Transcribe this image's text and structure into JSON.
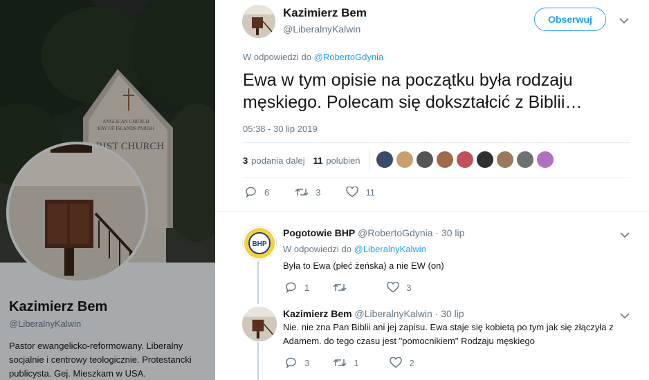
{
  "profile": {
    "name": "Kazimierz Bem",
    "handle": "@LiberalnyKalwin",
    "bio": "Pastor ewangelicko-reformowany. Liberalny socjalnie i centrowy teologicznie. Protestancki publicysta. Gej. Mieszkam w USA."
  },
  "banner_sign": {
    "line1": "ANGLICAN CHURCH",
    "line2": "BAY OF ISLANDS PARISH",
    "line3": "RIST CHURCH"
  },
  "tweet": {
    "author_name": "Kazimierz Bem",
    "author_handle": "@LiberalnyKalwin",
    "follow_label": "Obserwuj",
    "reply_prefix": "W odpowiedzi do",
    "reply_to": "@RobertoGdynia",
    "text": "Ewa w tym opisie na początku była rodzaju męskiego. Polecam się dokształcić z Biblii…",
    "timestamp": "05:38 - 30 lip 2019",
    "retweets_count": "3",
    "retweets_label": "podania dalej",
    "likes_count": "11",
    "likes_label": "polubień",
    "actions": {
      "reply": "6",
      "retweet": "3",
      "like": "11"
    },
    "liker_colors": [
      "#3a4a6a",
      "#c8a070",
      "#555555",
      "#a06a4a",
      "#c0505a",
      "#303030",
      "#9a7a5a",
      "#707070",
      "#b070c0"
    ]
  },
  "replies": [
    {
      "author_name": "Pogotowie BHP",
      "author_handle": "@RobertoGdynia",
      "date": "30 lip",
      "reply_prefix": "W odpowiedzi do",
      "reply_to": "@LiberalnyKalwin",
      "text": "Była to Ewa (płeć żeńska)  a nie EW (on)",
      "avatar_text": "BHP",
      "actions": {
        "reply": "1",
        "retweet": "",
        "like": "3"
      }
    },
    {
      "author_name": "Kazimierz Bem",
      "author_handle": "@LiberalnyKalwin",
      "date": "30 lip",
      "text": "Nie. nie zna Pan Biblii ani jej zapisu. Ewa staje się kobietą po tym jak się złączyła z Adamem. do tego czasu jest \"pomocnikiem\" Rodzaju męskiego",
      "actions": {
        "reply": "3",
        "retweet": "1",
        "like": "2"
      }
    }
  ],
  "separator": "·"
}
